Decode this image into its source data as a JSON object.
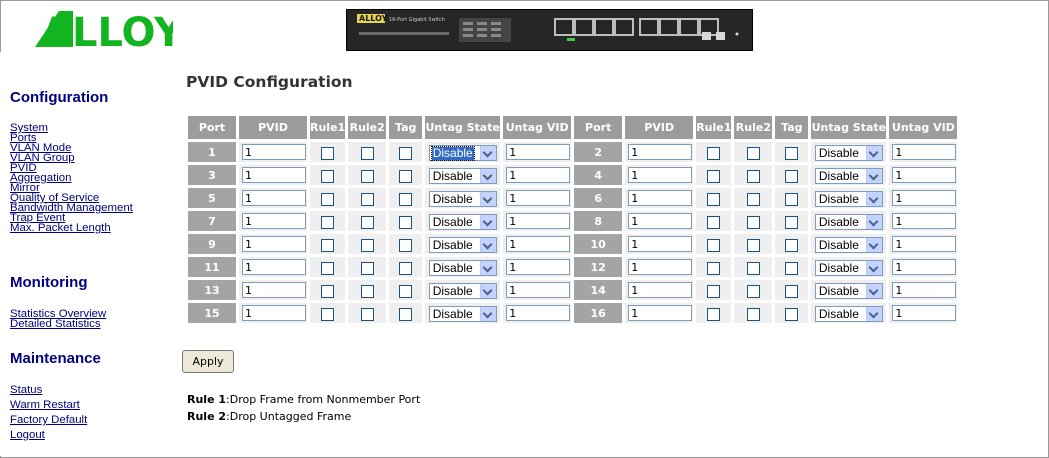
{
  "brand": {
    "logo_text": "ALLOY",
    "logo_color": "#12b51f",
    "device_label": "16-Port Gigabit Switch"
  },
  "sidebar": {
    "sections": [
      {
        "heading": "Configuration",
        "items": [
          "System",
          "Ports",
          "VLAN Mode",
          "VLAN Group",
          "PVID",
          "Aggregation",
          "Mirror",
          "Quality of Service",
          "Bandwidth Management",
          "Trap Event",
          "Max. Packet Length"
        ]
      },
      {
        "heading": "Monitoring",
        "items": [
          "Statistics Overview",
          "Detailed Statistics"
        ]
      },
      {
        "heading": "Maintenance",
        "items": [
          "Status",
          "Warm Restart",
          "Factory Default",
          "Logout"
        ]
      }
    ]
  },
  "main": {
    "title": "PVID Configuration",
    "columns": [
      "Port",
      "PVID",
      "Rule1",
      "Rule2",
      "Tag",
      "Untag State",
      "Untag VID"
    ],
    "rows": [
      {
        "port": "1",
        "pvid": "1",
        "rule1": false,
        "rule2": false,
        "tag": false,
        "untag_state": "Disable",
        "untag_vid": "1"
      },
      {
        "port": "2",
        "pvid": "1",
        "rule1": false,
        "rule2": false,
        "tag": false,
        "untag_state": "Disable",
        "untag_vid": "1"
      },
      {
        "port": "3",
        "pvid": "1",
        "rule1": false,
        "rule2": false,
        "tag": false,
        "untag_state": "Disable",
        "untag_vid": "1"
      },
      {
        "port": "4",
        "pvid": "1",
        "rule1": false,
        "rule2": false,
        "tag": false,
        "untag_state": "Disable",
        "untag_vid": "1"
      },
      {
        "port": "5",
        "pvid": "1",
        "rule1": false,
        "rule2": false,
        "tag": false,
        "untag_state": "Disable",
        "untag_vid": "1"
      },
      {
        "port": "6",
        "pvid": "1",
        "rule1": false,
        "rule2": false,
        "tag": false,
        "untag_state": "Disable",
        "untag_vid": "1"
      },
      {
        "port": "7",
        "pvid": "1",
        "rule1": false,
        "rule2": false,
        "tag": false,
        "untag_state": "Disable",
        "untag_vid": "1"
      },
      {
        "port": "8",
        "pvid": "1",
        "rule1": false,
        "rule2": false,
        "tag": false,
        "untag_state": "Disable",
        "untag_vid": "1"
      },
      {
        "port": "9",
        "pvid": "1",
        "rule1": false,
        "rule2": false,
        "tag": false,
        "untag_state": "Disable",
        "untag_vid": "1"
      },
      {
        "port": "10",
        "pvid": "1",
        "rule1": false,
        "rule2": false,
        "tag": false,
        "untag_state": "Disable",
        "untag_vid": "1"
      },
      {
        "port": "11",
        "pvid": "1",
        "rule1": false,
        "rule2": false,
        "tag": false,
        "untag_state": "Disable",
        "untag_vid": "1"
      },
      {
        "port": "12",
        "pvid": "1",
        "rule1": false,
        "rule2": false,
        "tag": false,
        "untag_state": "Disable",
        "untag_vid": "1"
      },
      {
        "port": "13",
        "pvid": "1",
        "rule1": false,
        "rule2": false,
        "tag": false,
        "untag_state": "Disable",
        "untag_vid": "1"
      },
      {
        "port": "14",
        "pvid": "1",
        "rule1": false,
        "rule2": false,
        "tag": false,
        "untag_state": "Disable",
        "untag_vid": "1"
      },
      {
        "port": "15",
        "pvid": "1",
        "rule1": false,
        "rule2": false,
        "tag": false,
        "untag_state": "Disable",
        "untag_vid": "1"
      },
      {
        "port": "16",
        "pvid": "1",
        "rule1": false,
        "rule2": false,
        "tag": false,
        "untag_state": "Disable",
        "untag_vid": "1"
      }
    ],
    "apply_label": "Apply",
    "notes": [
      {
        "label": "Rule 1",
        "text": ":Drop Frame from Nonmember Port"
      },
      {
        "label": "Rule 2",
        "text": ":Drop Untagged Frame"
      }
    ]
  },
  "colors": {
    "header_bg": "#9c9c9c",
    "port_bg": "#a4a4a4",
    "cell_bg": "#efefef",
    "link": "#000080"
  }
}
